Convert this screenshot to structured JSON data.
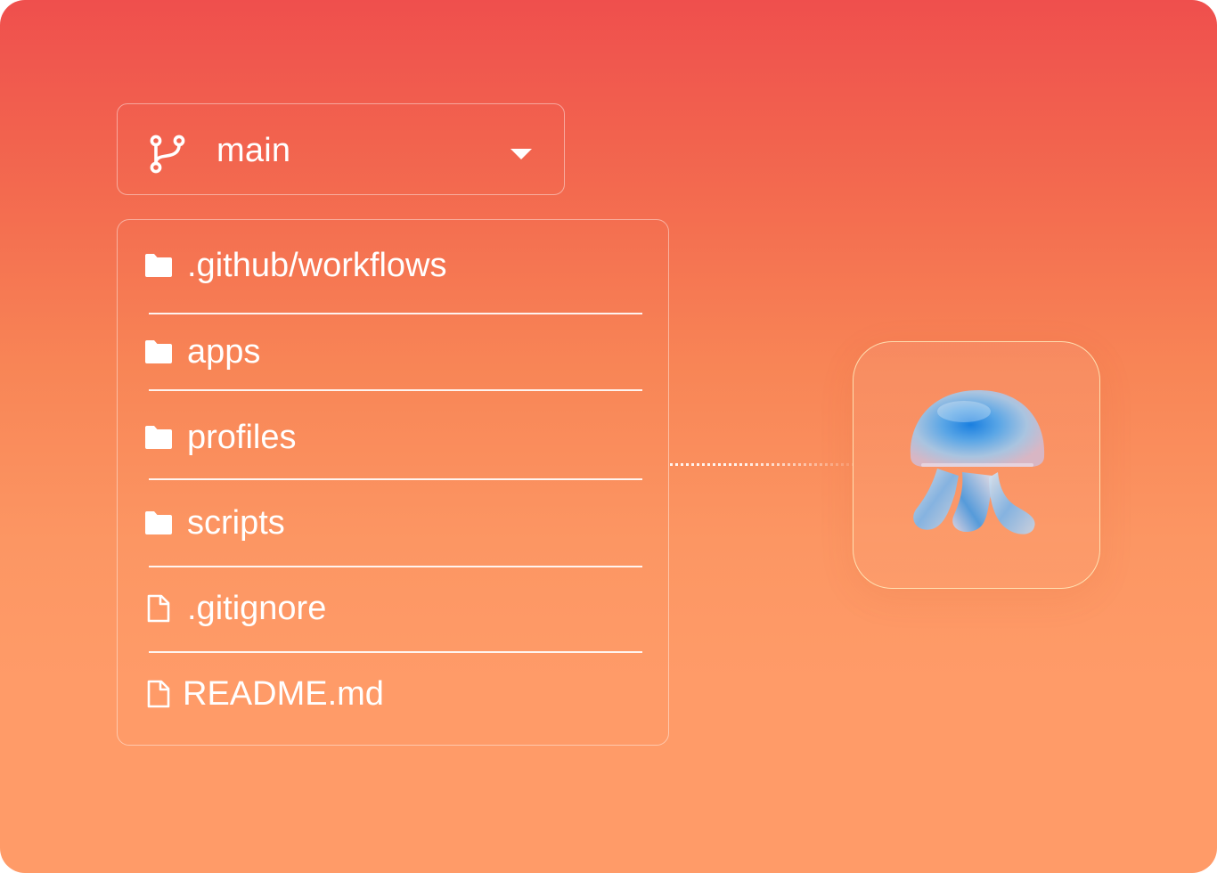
{
  "branch_selector": {
    "icon": "git-branch-icon",
    "label": "main",
    "dropdown_icon": "caret-down-icon"
  },
  "file_list": {
    "items": [
      {
        "name": ".github/workflows",
        "type": "folder",
        "icon": "folder-icon"
      },
      {
        "name": "apps",
        "type": "folder",
        "icon": "folder-icon"
      },
      {
        "name": "profiles",
        "type": "folder",
        "icon": "folder-icon"
      },
      {
        "name": "scripts",
        "type": "folder",
        "icon": "folder-icon"
      },
      {
        "name": ".gitignore",
        "type": "file",
        "icon": "file-icon"
      },
      {
        "name": "README.md",
        "type": "file",
        "icon": "file-icon"
      }
    ]
  },
  "app_tile": {
    "icon": "jellyfish-logo-icon"
  },
  "colors": {
    "background_top": "#ef4f4d",
    "background_bottom": "#ff9b68",
    "text": "#ffffff",
    "logo_blue": "#2f86d8"
  }
}
